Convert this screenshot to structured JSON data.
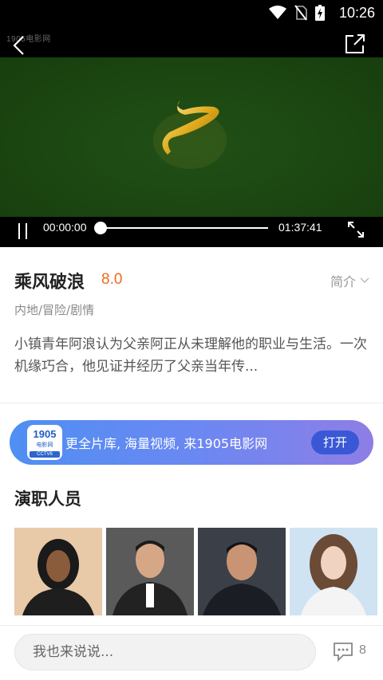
{
  "status_bar": {
    "time": "10:26",
    "icons": [
      "wifi-icon",
      "no-sim-icon",
      "battery-charging-icon"
    ]
  },
  "player": {
    "watermark": "1905电影网",
    "current_time": "00:00:00",
    "total_time": "01:37:41",
    "progress": 0
  },
  "movie": {
    "title": "乘风破浪",
    "score": "8.0",
    "intro_label": "简介",
    "genres": "内地/冒险/剧情",
    "description": "小镇青年阿浪认为父亲阿正从未理解他的职业与生活。一次机缘巧合，他见证并经历了父亲当年传..."
  },
  "promo": {
    "app_icon_text": "1905",
    "app_icon_sub": "电影网",
    "app_icon_tag": "CCTV6",
    "text": "更全片库, 海量视频, 来1905电影网",
    "button_label": "打开"
  },
  "cast": {
    "heading": "演职人员"
  },
  "comment": {
    "placeholder": "我也来说说...",
    "count": "8"
  },
  "colors": {
    "accent_score": "#f06a1d",
    "promo_gradient_start": "#4f8ff3",
    "promo_gradient_end": "#8e7ee6",
    "video_background": "#1e4a12"
  }
}
